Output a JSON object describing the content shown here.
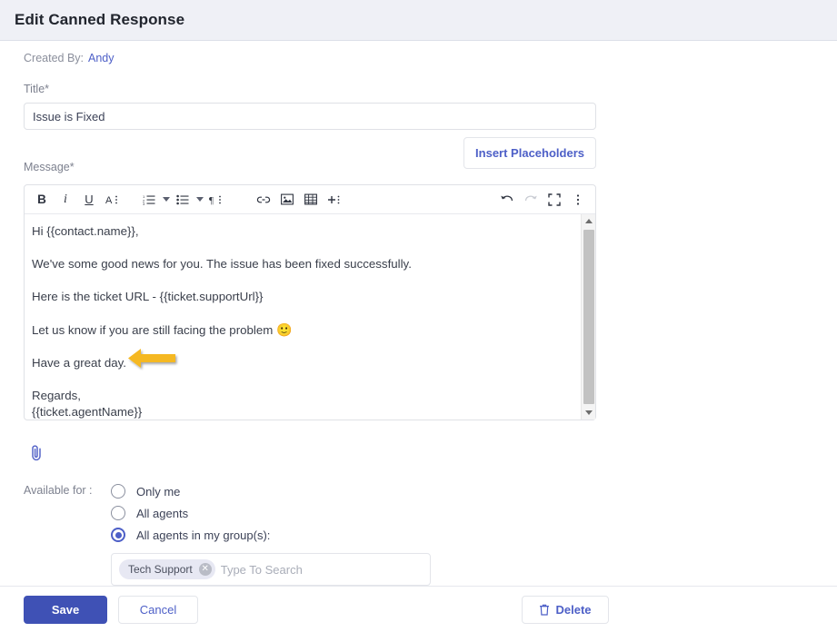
{
  "header": {
    "title": "Edit Canned Response"
  },
  "meta": {
    "created_by_label": "Created By:",
    "created_by_name": "Andy"
  },
  "title_field": {
    "label": "Title*",
    "value": "Issue is Fixed",
    "placeholder": "Title"
  },
  "message_field": {
    "label": "Message*",
    "insert_placeholders_label": "Insert Placeholders"
  },
  "toolbar": {
    "items": [
      {
        "name": "bold-icon",
        "glyph": "B"
      },
      {
        "name": "italic-icon",
        "glyph": "i"
      },
      {
        "name": "underline-icon",
        "glyph": "U"
      },
      {
        "name": "font-size-icon",
        "glyph": "A"
      },
      {
        "name": "ordered-list-icon",
        "glyph": ""
      },
      {
        "name": "unordered-list-icon",
        "glyph": ""
      },
      {
        "name": "paragraph-format-icon",
        "glyph": "¶"
      },
      {
        "name": "link-icon",
        "glyph": ""
      },
      {
        "name": "image-icon",
        "glyph": ""
      },
      {
        "name": "table-icon",
        "glyph": ""
      },
      {
        "name": "insert-more-icon",
        "glyph": "+"
      },
      {
        "name": "undo-icon",
        "glyph": ""
      },
      {
        "name": "redo-icon",
        "glyph": ""
      },
      {
        "name": "fullscreen-icon",
        "glyph": ""
      },
      {
        "name": "more-options-icon",
        "glyph": ""
      }
    ]
  },
  "message_body": {
    "line_greeting": "Hi {{contact.name}},",
    "line_news": "We've some good news for you. The issue has been fixed successfully.",
    "line_url": "Here is the ticket URL - {{ticket.supportUrl}}",
    "line_followup": "Let us know if you are still facing the problem",
    "emoji": "🙂",
    "line_closing": "Have a great day.",
    "line_regards": "Regards,",
    "line_agent": "{{ticket.agentName}}"
  },
  "attachment": {
    "icon_name": "paperclip-icon"
  },
  "availability": {
    "label": "Available for :",
    "options": [
      {
        "label": "Only me",
        "selected": false
      },
      {
        "label": "All agents",
        "selected": false
      },
      {
        "label": "All agents in my group(s):",
        "selected": true
      }
    ],
    "group_picker": {
      "chips": [
        {
          "label": "Tech Support"
        }
      ],
      "placeholder": "Type To Search"
    }
  },
  "footer": {
    "save_label": "Save",
    "cancel_label": "Cancel",
    "delete_label": "Delete"
  },
  "colors": {
    "accent": "#4d5fc7",
    "save_button": "#3f51b5",
    "header_bg": "#eff0f6",
    "annotation_arrow": "#f5b820"
  }
}
